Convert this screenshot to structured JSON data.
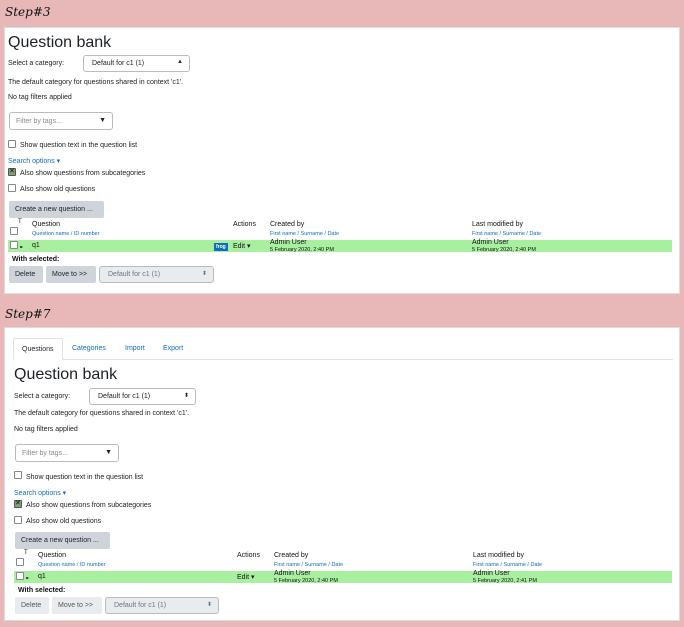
{
  "steps": [
    {
      "label": "Step#3",
      "title": "Question bank",
      "category_label": "Select a category:",
      "category_value": "Default for c1 (1)",
      "context_text": "The default category for questions shared in context 'c1'.",
      "tag_filter_text": "No tag filters applied",
      "filter_placeholder": "Filter by tags...",
      "show_text_label": "Show question text in the question list",
      "search_options": "Search options",
      "subcategories_label": "Also show questions from subcategories",
      "old_questions_label": "Also show old questions",
      "create_button": "Create a new question ...",
      "table": {
        "col_question": "Question",
        "col_question_sub": "Question name / ID number",
        "col_actions": "Actions",
        "col_created": "Created by",
        "col_created_sub": "First name / Surname / Date",
        "col_modified": "Last modified by",
        "col_modified_sub": "First name / Surname / Date",
        "sort_indicator": "T",
        "row": {
          "name": "q1",
          "tag": "frog",
          "edit": "Edit",
          "created_user": "Admin User",
          "created_date": "5 February 2020, 2:40 PM",
          "modified_user": "Admin User",
          "modified_date": "5 February 2020, 2:40 PM"
        }
      },
      "with_selected": "With selected:",
      "delete_button": "Delete",
      "move_button": "Move to >>",
      "move_target": "Default for c1 (1)"
    },
    {
      "label": "Step#7",
      "tabs": [
        "Questions",
        "Categories",
        "Import",
        "Export"
      ],
      "title": "Question bank",
      "category_label": "Select a category:",
      "category_value": "Default for c1 (1)",
      "context_text": "The default category for questions shared in context 'c1'.",
      "tag_filter_text": "No tag filters applied",
      "filter_placeholder": "Filter by tags...",
      "show_text_label": "Show question text in the question list",
      "search_options": "Search options",
      "subcategories_label": "Also show questions from subcategories",
      "old_questions_label": "Also show old questions",
      "create_button": "Create a new question ...",
      "table": {
        "col_question": "Question",
        "col_question_sub": "Question name / ID number",
        "col_actions": "Actions",
        "col_created": "Created by",
        "col_created_sub": "First name / Surname / Date",
        "col_modified": "Last modified by",
        "col_modified_sub": "First name / Surname / Date",
        "sort_indicator": "T",
        "row": {
          "name": "q1",
          "edit": "Edit",
          "created_user": "Admin User",
          "created_date": "5 February 2020, 2:40 PM",
          "modified_user": "Admin User",
          "modified_date": "5 February 2020, 2:41 PM"
        }
      },
      "with_selected": "With selected:",
      "delete_button": "Delete",
      "move_button": "Move to >>",
      "move_target": "Default for c1 (1)"
    }
  ],
  "colors": {
    "banner": "#e8b8b8",
    "row_highlight": "#a8f0a0",
    "link": "#0f6cbf",
    "tag": "#0f6cbf"
  },
  "icons": {
    "caret": "chevron-down-icon",
    "sort": "sort-asc-icon",
    "drag": "drag-handle-icon"
  }
}
